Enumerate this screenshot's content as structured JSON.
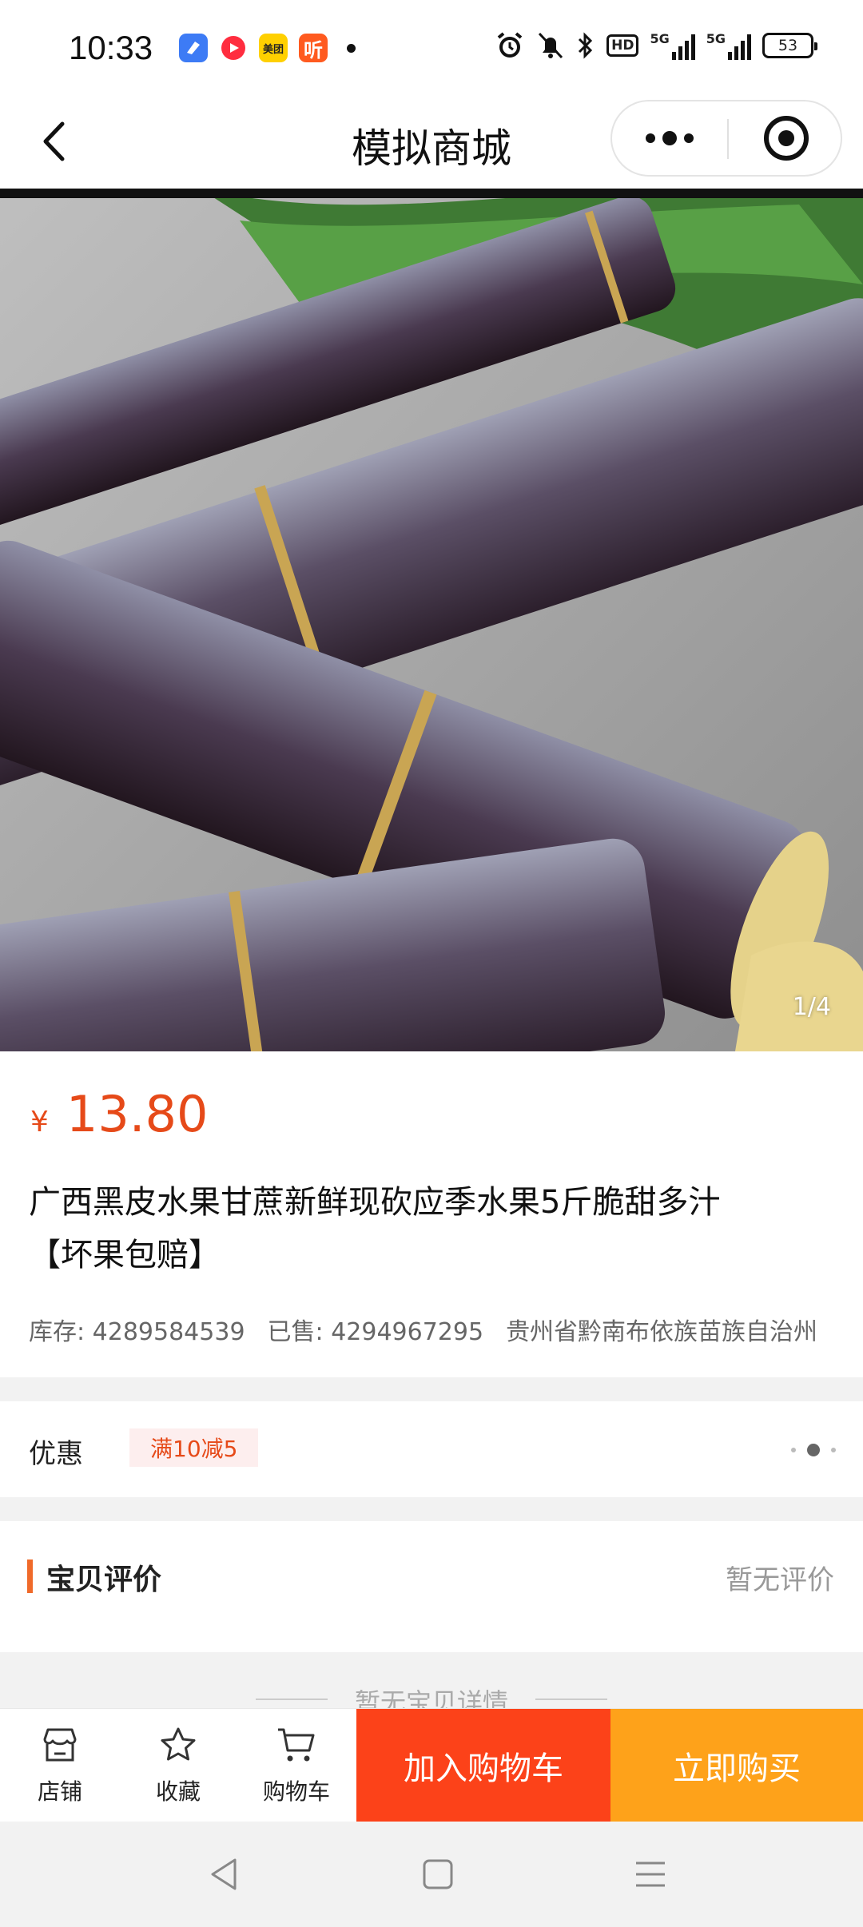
{
  "status_bar": {
    "time": "10:33",
    "notification_icons": [
      "blue-app-icon",
      "red-video-app-icon",
      "meituan-icon",
      "ting-icon"
    ],
    "meituan_label": "美团",
    "ting_label": "听",
    "hd_label": "HD",
    "network": "5G",
    "battery": "53"
  },
  "nav": {
    "title": "模拟商城"
  },
  "gallery": {
    "counter": "1/4"
  },
  "product": {
    "currency": "¥",
    "price": "13.80",
    "title": "广西黑皮水果甘蔗新鲜现砍应季水果5斤脆甜多汁【坏果包赔】",
    "stock_label": "库存:",
    "stock_value": "4289584539",
    "sold_label": "已售:",
    "sold_value": "4294967295",
    "location": "贵州省黔南布依族苗族自治州"
  },
  "promo": {
    "label": "优惠",
    "tag": "满10减5"
  },
  "reviews": {
    "title": "宝贝评价",
    "empty": "暂无评价"
  },
  "detail": {
    "empty": "暂无宝贝详情"
  },
  "bottom_bar": {
    "shop": "店铺",
    "favorite": "收藏",
    "cart": "购物车",
    "add_to_cart": "加入购物车",
    "buy_now": "立即购买"
  },
  "colors": {
    "price": "#e64a19",
    "add_to_cart_bg": "#fc4219",
    "buy_now_bg": "#fea21a",
    "review_accent": "#f06a2a"
  }
}
